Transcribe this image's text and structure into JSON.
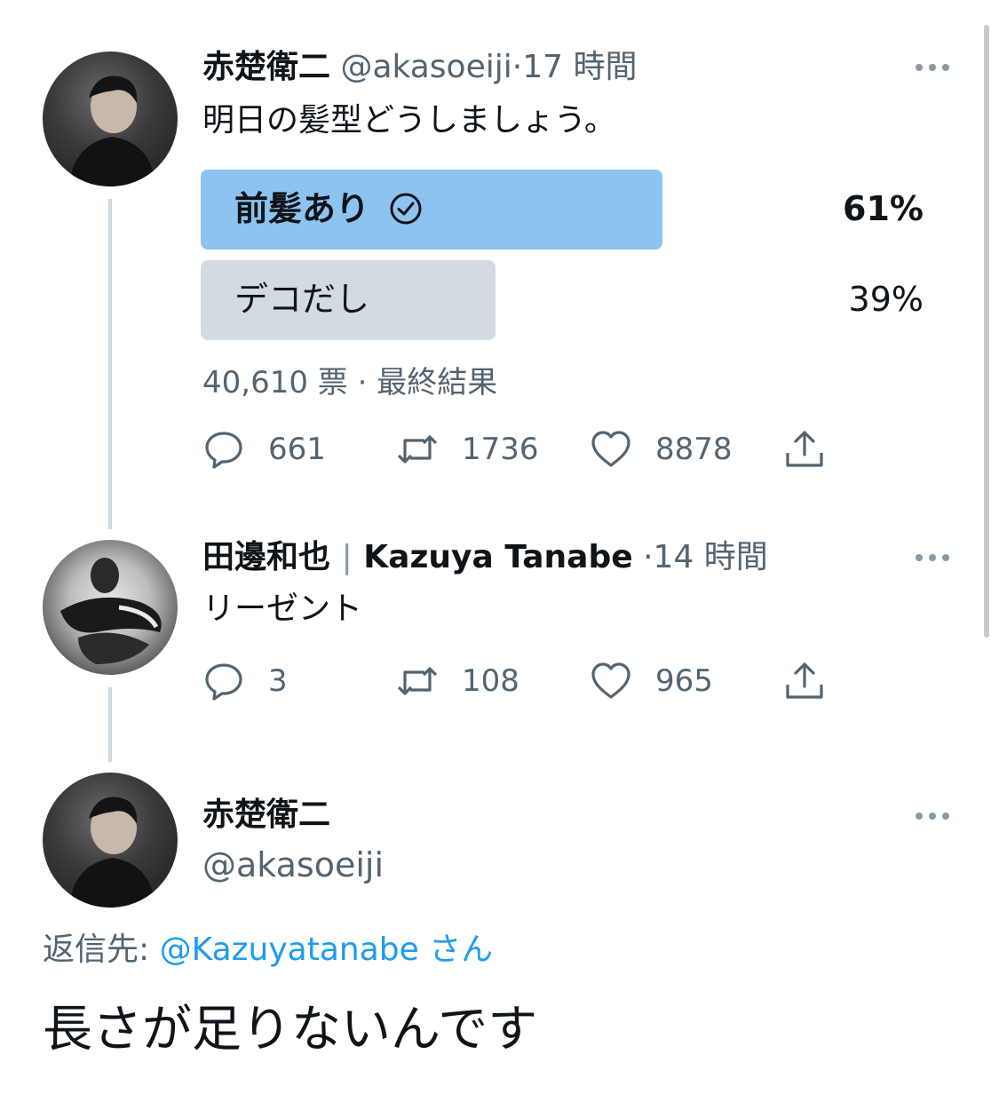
{
  "tweet1": {
    "name": "赤楚衛二",
    "handle": "@akasoeiji",
    "separator": "·",
    "time": "17 時間",
    "text": "明日の髪型どうしましょう。",
    "poll": {
      "options": [
        {
          "label": "前髪あり",
          "percent": "61%",
          "fraction": 0.61,
          "winner": true
        },
        {
          "label": "デコだし",
          "percent": "39%",
          "fraction": 0.39,
          "winner": false
        }
      ],
      "votes": "40,610 票",
      "separator": "·",
      "status": "最終結果"
    },
    "actions": {
      "replies": "661",
      "retweets": "1736",
      "likes": "8878"
    }
  },
  "tweet2": {
    "name": "田邊和也",
    "divider": "|",
    "name_en": "Kazuya Tanabe",
    "separator": "·",
    "time": "14 時間",
    "text": "リーゼント",
    "actions": {
      "replies": "3",
      "retweets": "108",
      "likes": "965"
    }
  },
  "tweet3": {
    "name": "赤楚衛二",
    "handle": "@akasoeiji",
    "reply_prefix": "返信先:",
    "reply_handle": "@Kazuyatanabe",
    "reply_suffix": "さん",
    "text": "長さが足りないんです"
  },
  "icons": {
    "more": "more-horizontal-icon",
    "reply": "reply-bubble-icon",
    "retweet": "retweet-icon",
    "like": "heart-icon",
    "share": "share-upload-icon",
    "check": "check-circle-icon"
  },
  "colors": {
    "poll_winner": "#8dc3ef",
    "poll_other": "#d3dae2",
    "link": "#1d9bf0",
    "secondary_text": "#536471",
    "thread_line": "#cfd9de"
  }
}
